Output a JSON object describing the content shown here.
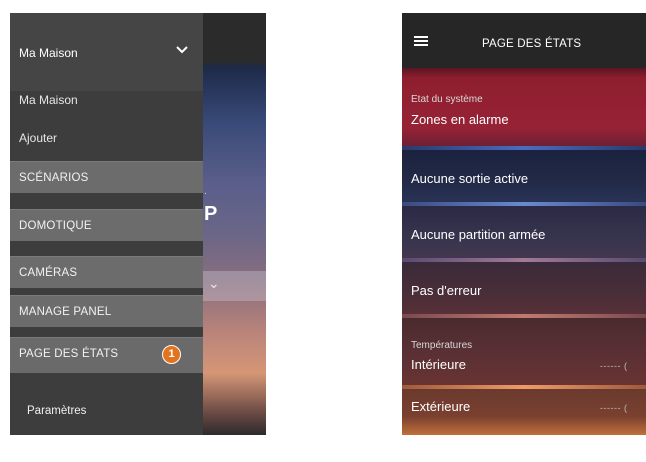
{
  "left_screen": {
    "house_selector": {
      "label": "Ma Maison",
      "icon": "chevron-down-icon"
    },
    "drawer_links": [
      "Ma Maison",
      "Ajouter"
    ],
    "menu": [
      {
        "label": "SCÉNARIOS"
      },
      {
        "label": "DOMOTIQUE"
      },
      {
        "label": "CAMÉRAS"
      },
      {
        "label": "MANAGE PANEL"
      },
      {
        "label": "PAGE DES ÉTATS",
        "badge": "1"
      }
    ],
    "settings_label": "Paramètres",
    "accent_color": "#e2731f"
  },
  "right_screen": {
    "header": {
      "title": "PAGE DES ÉTATS",
      "menu_icon": "hamburger-menu-icon"
    },
    "system_status": {
      "label": "Etat du système",
      "value": "Zones en alarme",
      "color": "#8e1e2e"
    },
    "status_rows": [
      "Aucune sortie active",
      "Aucune partition armée",
      "Pas d'erreur"
    ],
    "temperatures": {
      "label": "Températures",
      "rows": [
        {
          "name": "Intérieure",
          "value": "------ ("
        },
        {
          "name": "Extérieure",
          "value": "------ ("
        }
      ]
    }
  }
}
